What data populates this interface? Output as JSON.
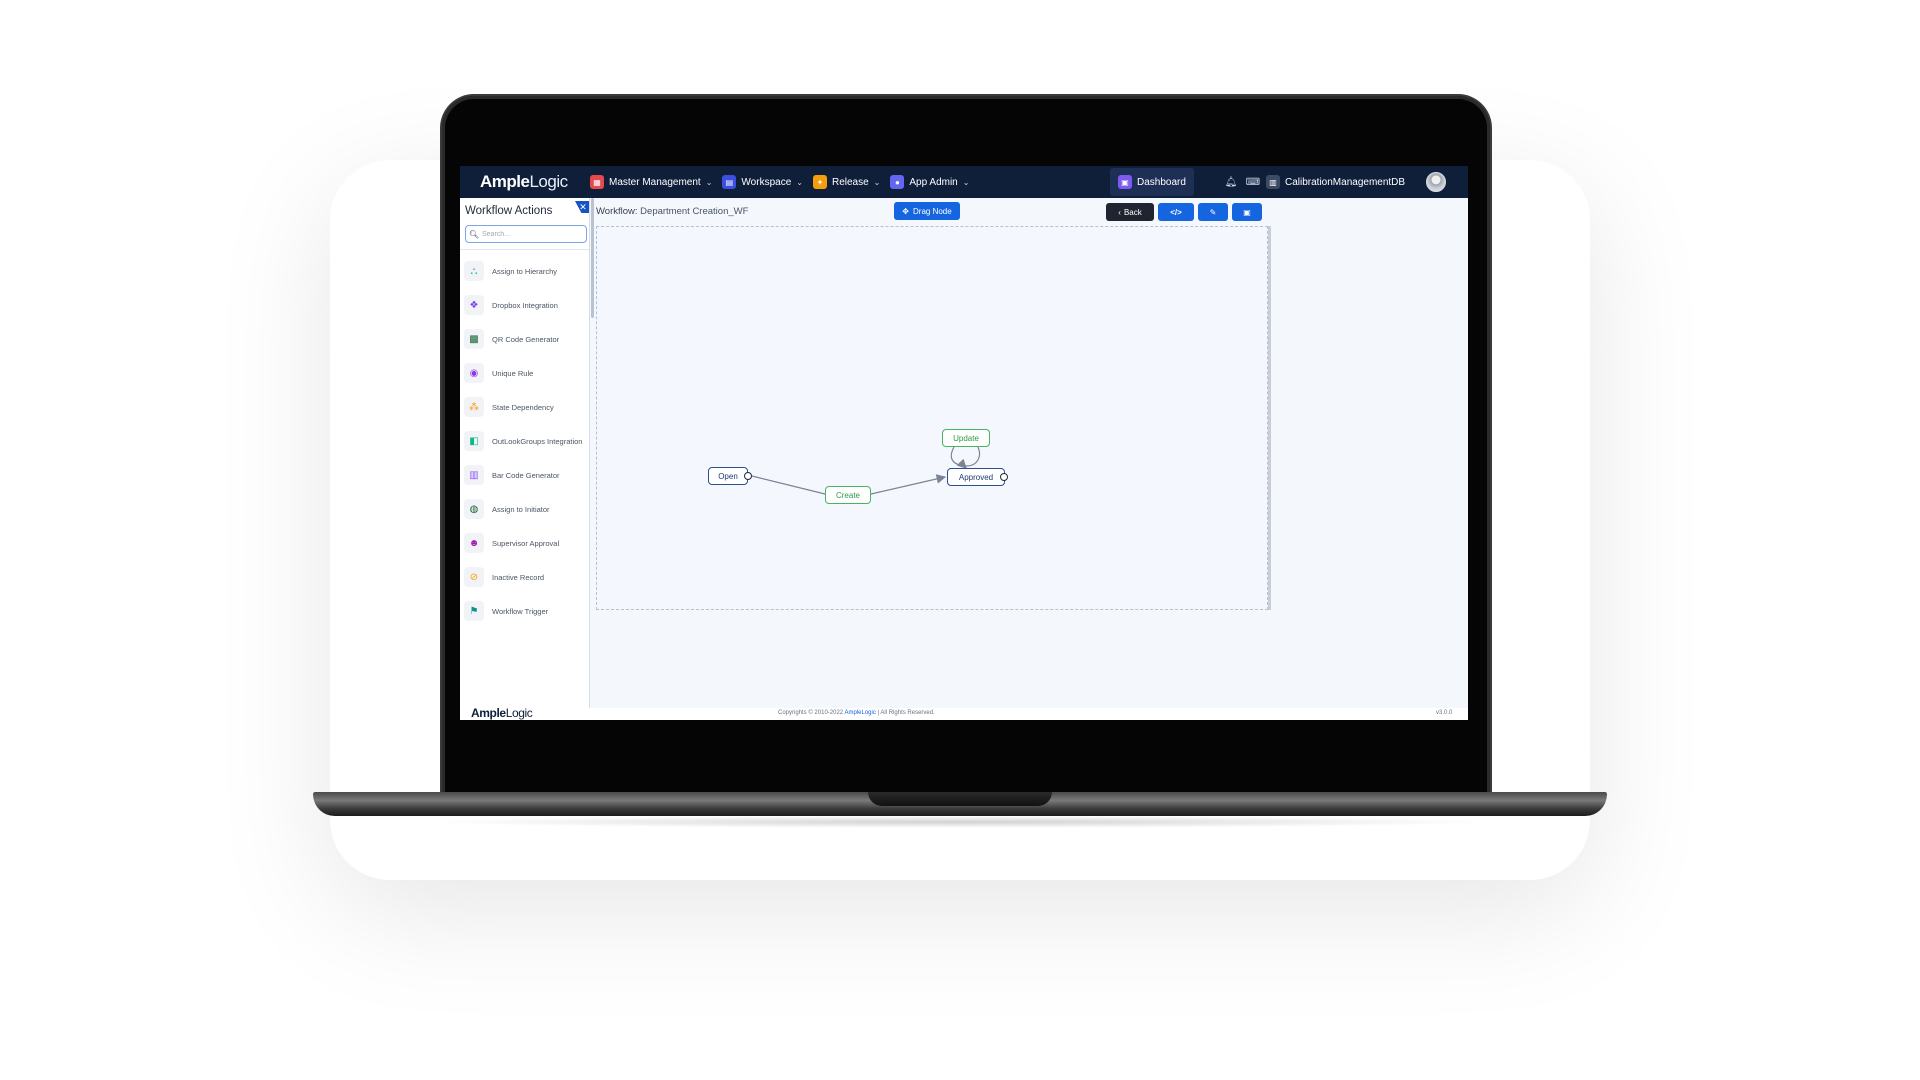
{
  "app": {
    "logo_bold": "Ample",
    "logo_thin": "Logic",
    "copyright_prefix": "Copyrights © 2010-2022 ",
    "copyright_link": "AmpleLogic",
    "copyright_suffix": " | All Rights Reserved.",
    "version": "v3.0.0"
  },
  "nav": {
    "items": [
      {
        "label": "Master Management",
        "icon": "master-icon",
        "color": "#e5484d"
      },
      {
        "label": "Workspace",
        "icon": "workspace-icon",
        "color": "#3b4fe0"
      },
      {
        "label": "Release",
        "icon": "release-icon",
        "color": "#f59e0b"
      },
      {
        "label": "App Admin",
        "icon": "admin-icon",
        "color": "#6366f1"
      }
    ],
    "dashboard": "Dashboard",
    "database": "CalibrationManagementDB"
  },
  "sidebar": {
    "title": "Workflow Actions",
    "search_placeholder": "Search...",
    "items": [
      {
        "label": "Assign to Hierarchy",
        "icon": "hierarchy-icon",
        "color": "#14b8a6"
      },
      {
        "label": "Dropbox Integration",
        "icon": "dropbox-icon",
        "color": "#7c3aed"
      },
      {
        "label": "QR Code Generator",
        "icon": "qr-code-icon",
        "color": "#166534"
      },
      {
        "label": "Unique Rule",
        "icon": "unique-rule-icon",
        "color": "#9333ea"
      },
      {
        "label": "State Dependency",
        "icon": "state-dependency-icon",
        "color": "#f59e0b"
      },
      {
        "label": "OutLookGroups Integration",
        "icon": "outlook-icon",
        "color": "#10b981"
      },
      {
        "label": "Bar Code Generator",
        "icon": "barcode-icon",
        "color": "#8b5cf6"
      },
      {
        "label": "Assign to Initiator",
        "icon": "initiator-icon",
        "color": "#166534"
      },
      {
        "label": "Supervisor Approval",
        "icon": "supervisor-icon",
        "color": "#a21caf"
      },
      {
        "label": "Inactive Record",
        "icon": "inactive-icon",
        "color": "#f59e0b"
      },
      {
        "label": "Workflow Trigger",
        "icon": "trigger-icon",
        "color": "#0d9488"
      }
    ]
  },
  "main": {
    "workflow_label": "Workflow:",
    "workflow_name": "Department Creation_WF",
    "drag_node": "Drag Node",
    "back": "Back"
  },
  "workflow": {
    "nodes": {
      "open": "Open",
      "create": "Create",
      "approved": "Approved",
      "update": "Update"
    }
  }
}
